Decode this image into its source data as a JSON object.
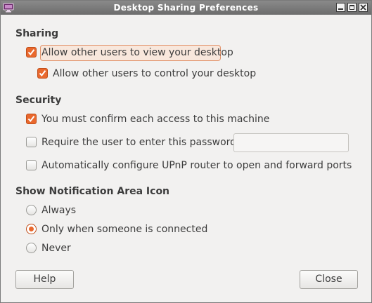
{
  "window": {
    "title": "Desktop Sharing Preferences"
  },
  "sharing": {
    "heading": "Sharing",
    "view_label": "Allow other users to view your desktop",
    "view_checked": true,
    "control_label": "Allow other users to control your desktop",
    "control_checked": true
  },
  "security": {
    "heading": "Security",
    "confirm_label": "You must confirm each access to this machine",
    "confirm_checked": true,
    "password_label": "Require the user to enter this password:",
    "password_checked": false,
    "password_value": "",
    "upnp_label": "Automatically configure UPnP router to open and forward ports",
    "upnp_checked": false
  },
  "notification": {
    "heading": "Show Notification Area Icon",
    "options": [
      "Always",
      "Only when someone is connected",
      "Never"
    ],
    "selected": "Only when someone is connected"
  },
  "buttons": {
    "help": "Help",
    "close": "Close"
  },
  "colors": {
    "accent": "#e9682d",
    "titlebar": "#7a7a7a",
    "background": "#f2f1f0"
  },
  "icons": {
    "app": "desktop-sharing-icon",
    "window_controls": [
      "minimize-icon",
      "maximize-icon",
      "close-icon"
    ],
    "checkmark": "checkmark-icon"
  }
}
